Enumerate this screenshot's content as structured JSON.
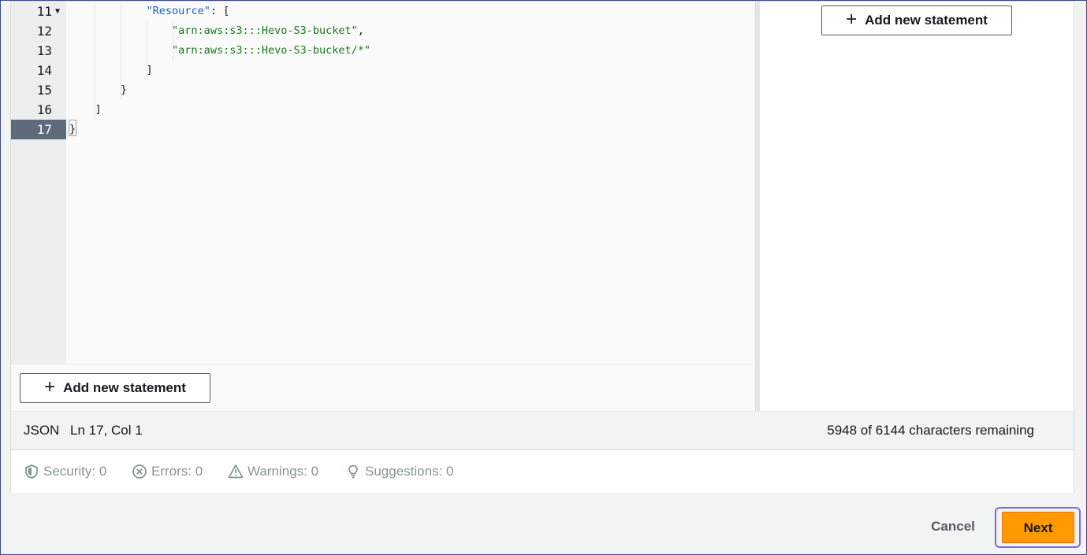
{
  "editor": {
    "line_numbers": [
      "11",
      "12",
      "13",
      "14",
      "15",
      "16",
      "17"
    ],
    "lines": [
      {
        "indent": "            ",
        "key": "\"Resource\"",
        "rest": ": ["
      },
      {
        "indent": "                ",
        "str": "\"arn:aws:s3:::Hevo-S3-bucket\"",
        "rest": ","
      },
      {
        "indent": "                ",
        "str": "\"arn:aws:s3:::Hevo-S3-bucket/*\"",
        "rest": ""
      },
      {
        "indent": "            ",
        "rest": "]"
      },
      {
        "indent": "        ",
        "rest": "}"
      },
      {
        "indent": "    ",
        "rest": "]"
      },
      {
        "indent": "",
        "rest": "}"
      }
    ],
    "fold_icon": "triangle-down-icon",
    "add_statement_label": "Add new statement"
  },
  "side_panel": {
    "add_statement_label": "Add new statement"
  },
  "status": {
    "language": "JSON",
    "cursor_position": "Ln 17, Col 1",
    "chars_remaining": "5948 of 6144 characters remaining"
  },
  "validation": {
    "security": "Security: 0",
    "errors": "Errors: 0",
    "warnings": "Warnings: 0",
    "suggestions": "Suggestions: 0"
  },
  "footer": {
    "cancel_label": "Cancel",
    "next_label": "Next"
  },
  "colors": {
    "primary_button": "#ff9900",
    "focus_ring": "#7b6bdc",
    "active_line_number": "#5f6b7a"
  }
}
